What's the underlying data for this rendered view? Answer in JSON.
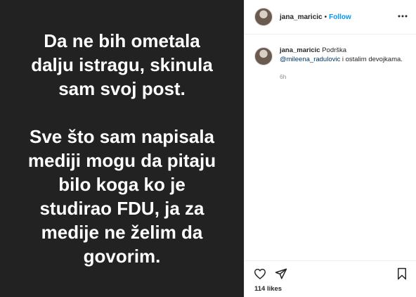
{
  "post": {
    "image_text": {
      "paragraph1": [
        "Da ne bih ometala",
        "dalju istragu, skinula",
        "sam svoj post."
      ],
      "paragraph2": [
        "Sve što sam napisala",
        "mediji mogu da pitaju",
        "bilo koga ko je",
        "studirao FDU, ja za",
        "medije ne želim da",
        "govorim."
      ]
    }
  },
  "header": {
    "username": "jana_maricic",
    "separator": "•",
    "follow_label": "Follow",
    "more_icon": "more-horizontal-icon"
  },
  "caption": {
    "username": "jana_maricic",
    "text_before": "Podrška",
    "mention": "@mileena_radulovic",
    "text_after": "i ostalim devojkama.",
    "time": "6h"
  },
  "actions": {
    "icons": [
      "heart-icon",
      "send-icon",
      "bookmark-icon"
    ],
    "likes": "114 likes"
  },
  "colors": {
    "image_bg": "#222222",
    "follow_blue": "#0095f6",
    "mention_blue": "#00376b",
    "muted": "#8e8e8e"
  }
}
